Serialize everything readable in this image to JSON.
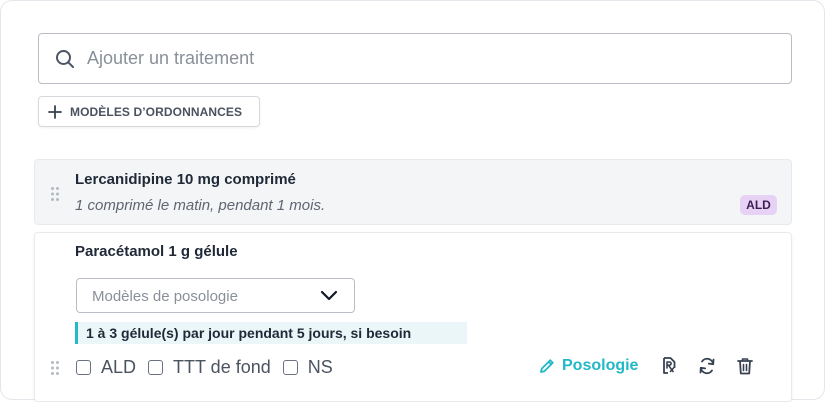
{
  "search": {
    "placeholder": "Ajouter un traitement",
    "value": ""
  },
  "templates_button": {
    "label": "MODÈLES D’ORDONNANCES"
  },
  "prescriptions": [
    {
      "name": "Lercanidipine 10 mg comprimé",
      "dosage": "1 comprimé le matin, pendant 1 mois.",
      "badge": "ALD"
    },
    {
      "name": "Paracétamol 1 g gélule",
      "posology_select_placeholder": "Modèles de posologie",
      "instruction": "1 à 3 gélule(s) par jour pendant 5 jours, si besoin",
      "checkboxes": [
        {
          "label": "ALD",
          "checked": false
        },
        {
          "label": "TTT de fond",
          "checked": false
        },
        {
          "label": "NS",
          "checked": false
        }
      ],
      "posologie_button": "Posologie"
    }
  ],
  "colors": {
    "accent": "#22b8c8",
    "ald_badge_bg": "#e7d2f6",
    "row_bg": "#f3f5f6"
  },
  "icons": [
    "search-icon",
    "plus-icon",
    "drag-handle-icon",
    "chevron-down-icon",
    "pencil-icon",
    "prescription-file-icon",
    "refresh-icon",
    "trash-icon"
  ]
}
